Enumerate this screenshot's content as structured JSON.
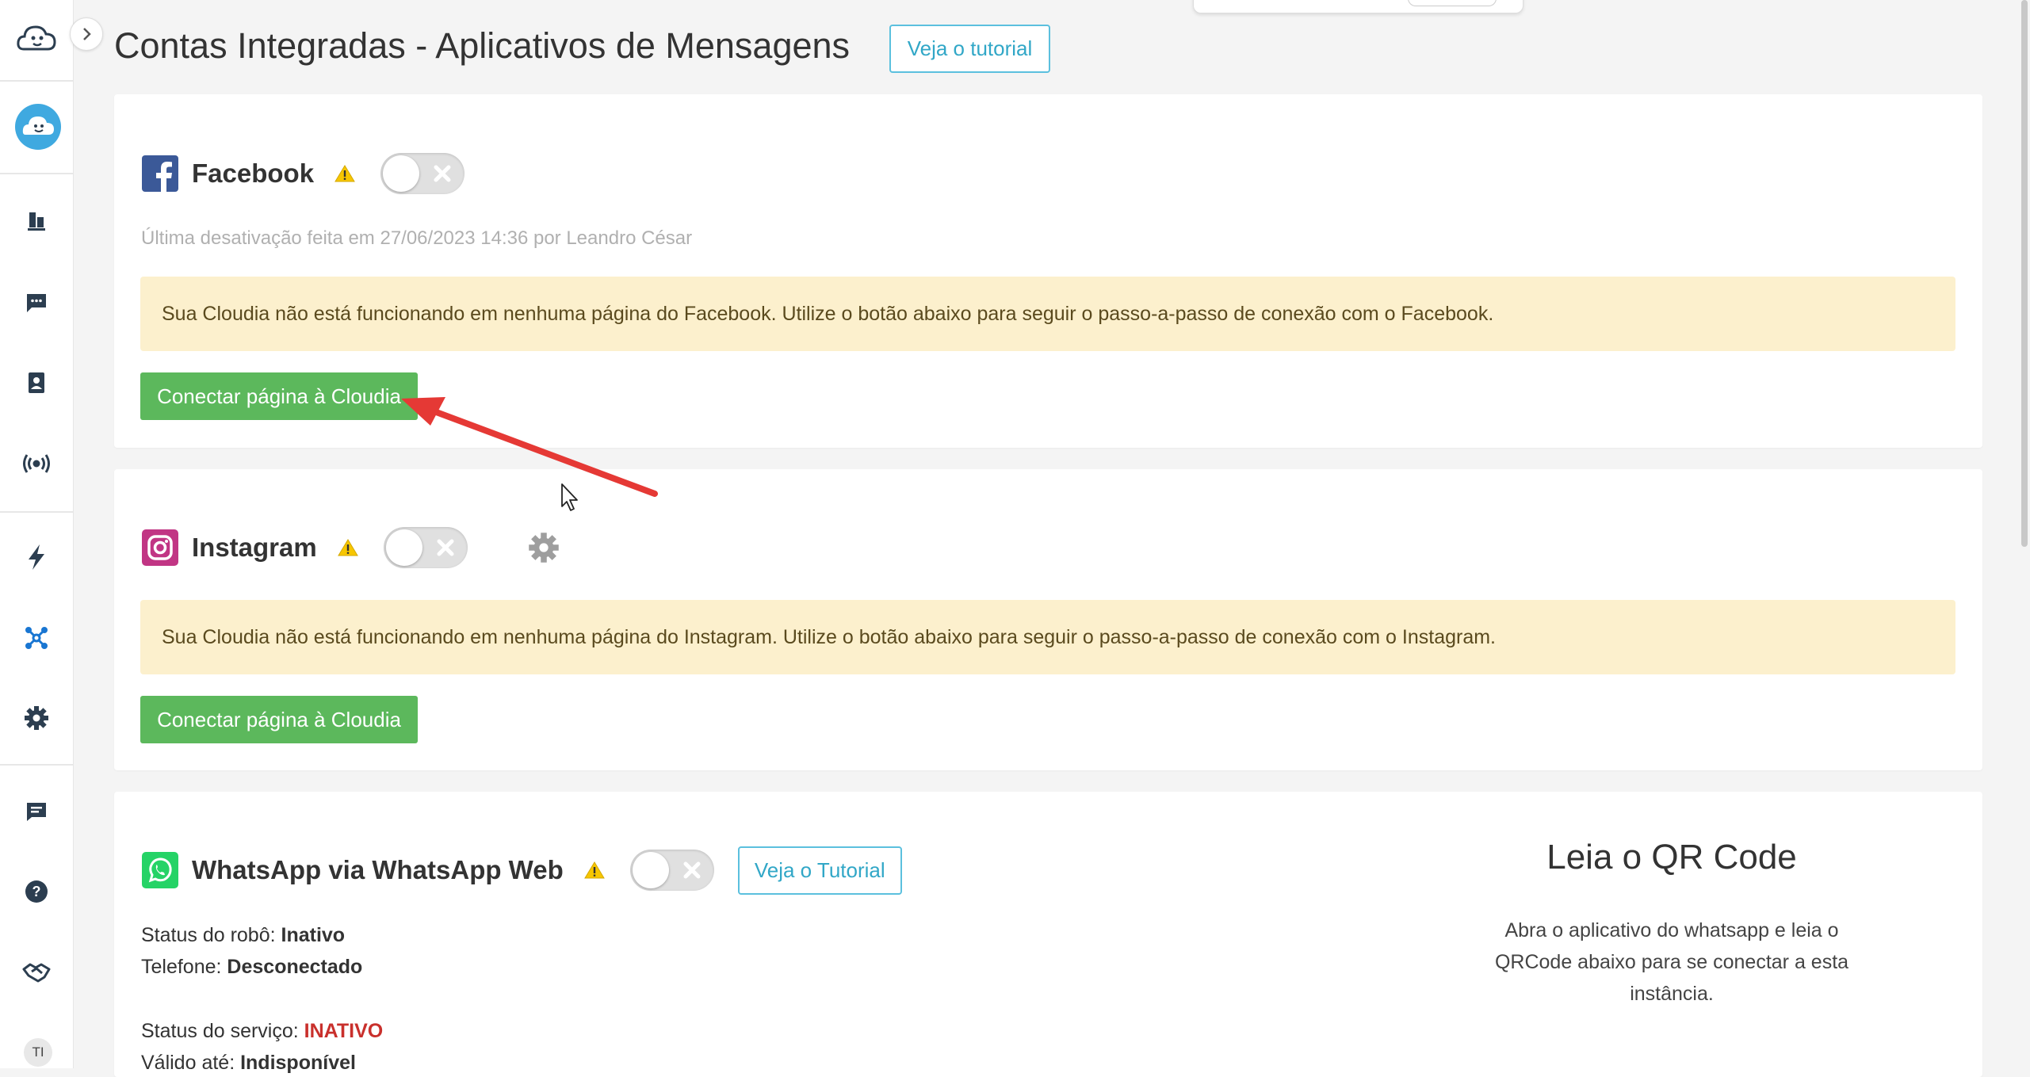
{
  "header": {
    "title": "Contas Integradas - Aplicativos de Mensagens",
    "tutorial_label": "Veja o tutorial"
  },
  "sidebar": {
    "items": [
      {
        "icon": "cloudia-logo-icon"
      },
      {
        "icon": "profile-avatar-icon"
      },
      {
        "icon": "dashboard-chart-icon"
      },
      {
        "icon": "chat-icon"
      },
      {
        "icon": "contacts-icon"
      },
      {
        "icon": "broadcast-icon"
      },
      {
        "icon": "lightning-icon"
      },
      {
        "icon": "integrations-icon"
      },
      {
        "icon": "settings-gear-icon"
      },
      {
        "icon": "messages-icon"
      },
      {
        "icon": "help-icon"
      },
      {
        "icon": "handshake-icon"
      }
    ],
    "user_initials": "TI"
  },
  "facebook": {
    "name": "Facebook",
    "last_deactivation": "Última desativação feita em 27/06/2023 14:36 por Leandro César",
    "alert": "Sua Cloudia não está funcionando em nenhuma página do Facebook. Utilize o botão abaixo para seguir o passo-a-passo de conexão com o Facebook.",
    "connect_label": "Conectar página à Cloudia",
    "enabled": false
  },
  "instagram": {
    "name": "Instagram",
    "alert": "Sua Cloudia não está funcionando em nenhuma página do Instagram. Utilize o botão abaixo para seguir o passo-a-passo de conexão com o Instagram.",
    "connect_label": "Conectar página à Cloudia",
    "enabled": false
  },
  "whatsapp": {
    "name": "WhatsApp via WhatsApp Web",
    "tutorial_label": "Veja o Tutorial",
    "robot_status_label": "Status do robô:",
    "robot_status_value": "Inativo",
    "phone_label": "Telefone:",
    "phone_value": "Desconectado",
    "service_status_label": "Status do serviço:",
    "service_status_value": "INATIVO",
    "valid_until_label": "Válido até:",
    "valid_until_value": "Indisponível",
    "qr_title": "Leia o QR Code",
    "qr_description": "Abra o aplicativo do whatsapp e leia o QRCode abaixo para se conectar a esta instância.",
    "enabled": false
  },
  "colors": {
    "accent_green": "#5cb85c",
    "info_blue": "#5bc0de",
    "alert_bg": "#fcf0cd",
    "danger_red": "#c9302c",
    "annotation_arrow": "#e53935"
  }
}
